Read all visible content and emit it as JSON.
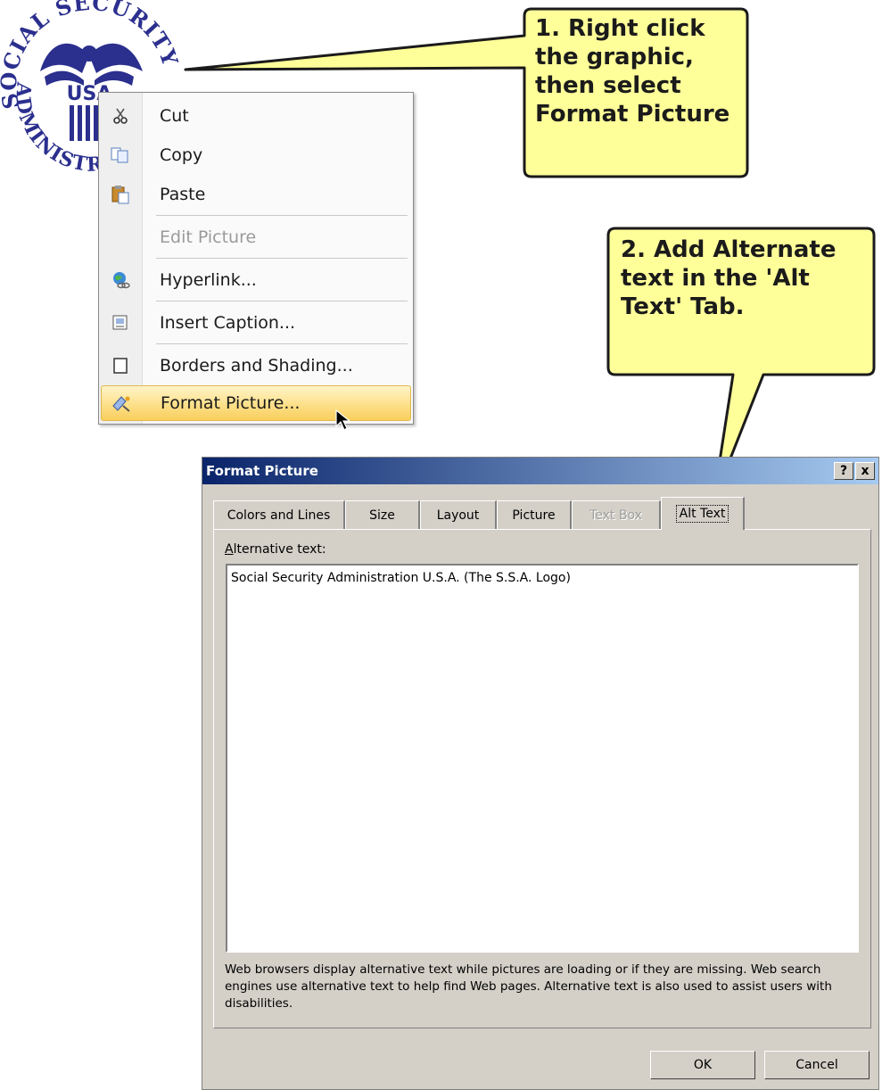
{
  "logo": {
    "arc_text": "SOCIAL SECURITY",
    "arc_text_bottom": "ADMINISTRATION",
    "center_text": "USA",
    "color": "#2b2f8e"
  },
  "context_menu": {
    "items": [
      {
        "label": "Cut",
        "icon": "scissors-icon",
        "disabled": false
      },
      {
        "label": "Copy",
        "icon": "copy-icon",
        "disabled": false
      },
      {
        "label": "Paste",
        "icon": "paste-icon",
        "disabled": false
      },
      {
        "label": "Edit Picture",
        "icon": "",
        "disabled": true
      },
      {
        "label": "Hyperlink...",
        "icon": "globe-link-icon",
        "disabled": false
      },
      {
        "label": "Insert Caption...",
        "icon": "caption-icon",
        "disabled": false
      },
      {
        "label": "Borders and Shading...",
        "icon": "page-icon",
        "disabled": false
      },
      {
        "label": "Format Picture...",
        "icon": "format-picture-icon",
        "disabled": false,
        "selected": true
      }
    ]
  },
  "callouts": {
    "step1": [
      "1. Right click",
      "the graphic,",
      "then select",
      "Format Picture"
    ],
    "step2": [
      "2. Add Alternate",
      "text in the 'Alt",
      "Text' Tab."
    ],
    "fill": "#ffff99"
  },
  "dialog": {
    "title": "Format Picture",
    "help_button": "?",
    "close_button": "x",
    "tabs": [
      "Colors and Lines",
      "Size",
      "Layout",
      "Picture",
      "Text Box",
      "Alt Text"
    ],
    "active_tab": "Alt Text",
    "alt_label_prefix": "A",
    "alt_label_rest": "lternative text:",
    "alt_text_value": "Social Security Administration U.S.A. (The S.S.A. Logo)",
    "help_text": "Web browsers display alternative text while pictures are loading or if they are missing.   Web search engines use alternative text to help find Web pages.  Alternative text is also used to assist users with disabilities.",
    "ok_label": "OK",
    "cancel_label": "Cancel"
  }
}
